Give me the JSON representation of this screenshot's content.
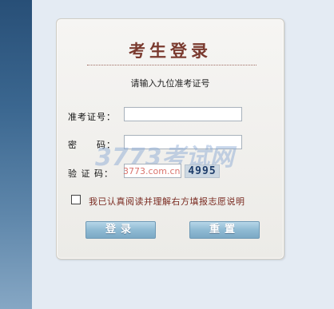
{
  "panel": {
    "title": "考生登录",
    "hint": "请输入九位准考证号"
  },
  "fields": {
    "exam_id_label": "准考证号：",
    "exam_id_value": "",
    "password_label": "密　　码：",
    "password_value": "",
    "captcha_label": "验 证 码：",
    "captcha_value": "",
    "captcha_code": "4995"
  },
  "watermark": {
    "logo": "3773考试网",
    "url": "3773.com.cn"
  },
  "agreement": {
    "checked": false,
    "label": "我已认真阅读并理解右方填报志愿说明"
  },
  "buttons": {
    "login": "登录",
    "reset": "重置"
  },
  "colors": {
    "title": "#7a3a2f",
    "agreement_text": "#7a2a20",
    "button_blue": "#8fbad3",
    "side_strip": "#3b6790"
  }
}
